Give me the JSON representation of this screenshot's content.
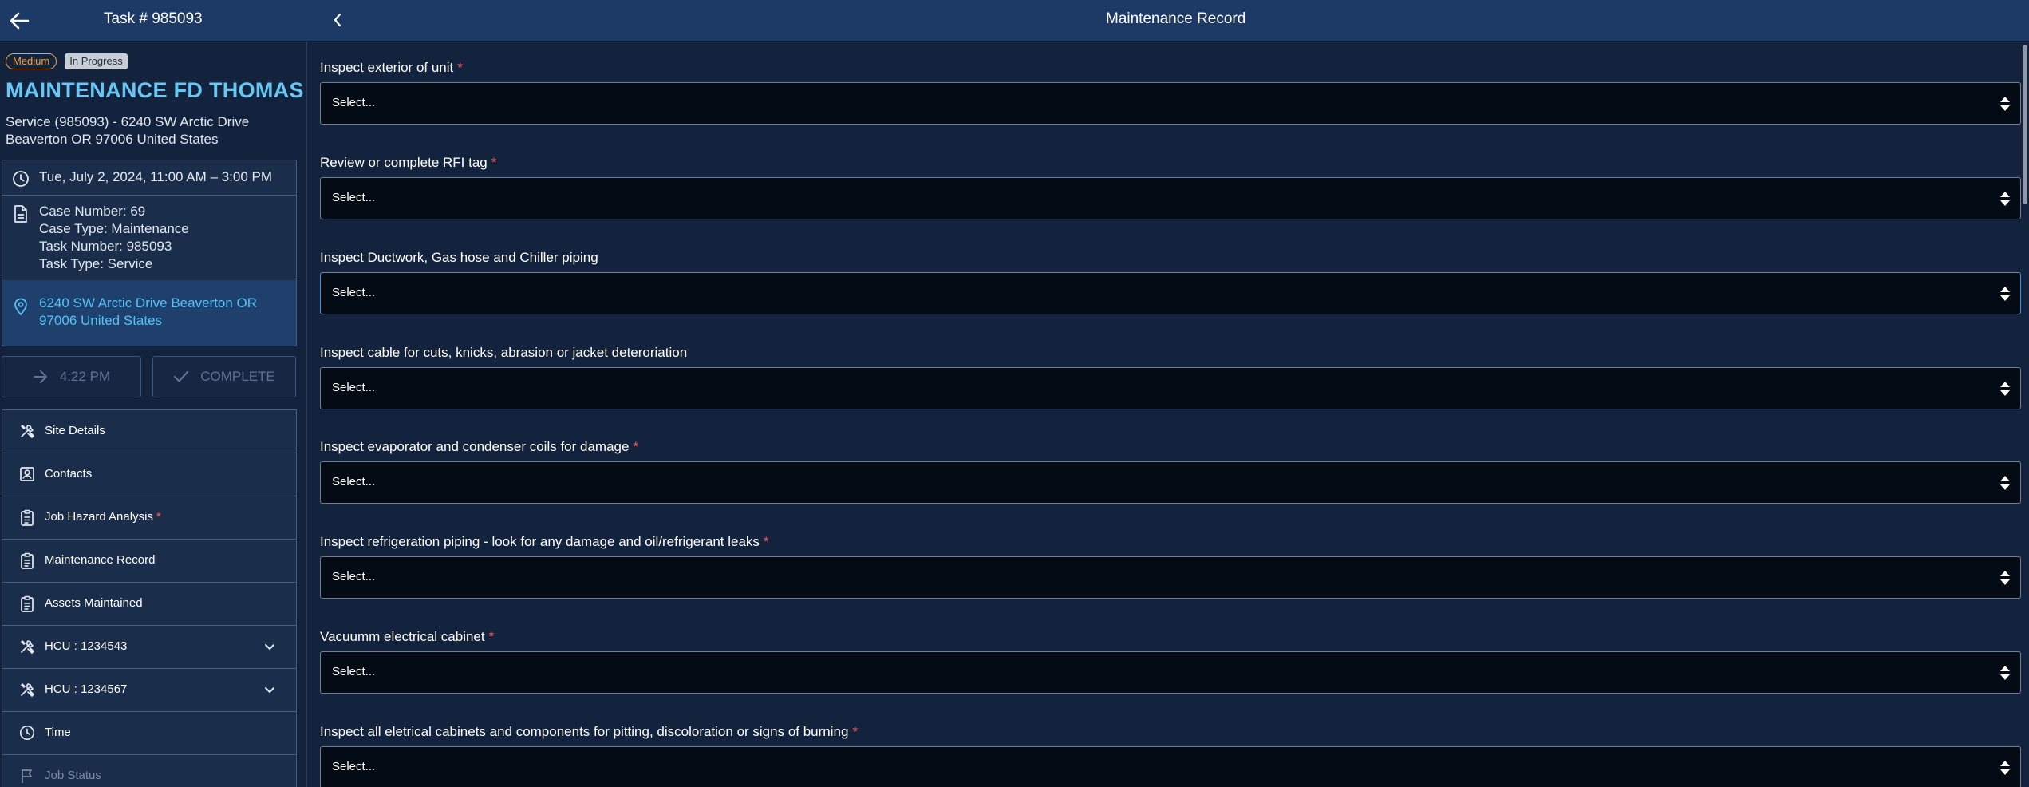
{
  "topbar": {
    "task_label": "Task # 985093",
    "page_title": "Maintenance Record"
  },
  "sidebar": {
    "badge_priority": "Medium",
    "badge_status": "In Progress",
    "title": "MAINTENANCE FD THOMAS",
    "subtitle_line1": "Service (985093) - 6240 SW Arctic Drive",
    "subtitle_line2": "Beaverton OR 97006 United States",
    "schedule": "Tue, July 2, 2024, 11:00 AM – 3:00 PM",
    "case_number": "Case Number: 69",
    "case_type": "Case Type: Maintenance",
    "task_number": "Task Number: 985093",
    "task_type": "Task Type: Service",
    "address": "6240 SW Arctic Drive Beaverton OR 97006 United States",
    "time_button": "4:22 PM",
    "complete_button": "COMPLETE",
    "nav": [
      {
        "label": "Site Details"
      },
      {
        "label": "Contacts"
      },
      {
        "label": "Job Hazard Analysis"
      },
      {
        "label": "Maintenance Record"
      },
      {
        "label": "Assets Maintained"
      },
      {
        "label": "HCU : 1234543"
      },
      {
        "label": "HCU : 1234567"
      },
      {
        "label": "Time"
      },
      {
        "label": "Job Status"
      }
    ],
    "required_mark": "*"
  },
  "form": {
    "fields": [
      {
        "label": "Inspect exterior of unit",
        "required": true,
        "value": "Select..."
      },
      {
        "label": "Review or complete RFI tag",
        "required": true,
        "value": "Select..."
      },
      {
        "label": "Inspect Ductwork, Gas hose and Chiller piping",
        "required": false,
        "value": "Select..."
      },
      {
        "label": "Inspect cable for cuts, knicks, abrasion or jacket deteroriation",
        "required": false,
        "value": "Select..."
      },
      {
        "label": "Inspect evaporator and condenser coils for damage",
        "required": true,
        "value": "Select..."
      },
      {
        "label": "Inspect refrigeration piping - look for any damage and oil/refrigerant leaks",
        "required": true,
        "value": "Select..."
      },
      {
        "label": "Vacuumm electrical cabinet",
        "required": true,
        "value": "Select..."
      },
      {
        "label": "Inspect all eletrical cabinets and components for pitting, discoloration or signs of burning",
        "required": true,
        "value": "Select..."
      }
    ],
    "required_mark": "*"
  },
  "colors": {
    "header_bg": "#1d3a66",
    "page_bg": "#13233d",
    "accent_title": "#66c7f4",
    "address_link": "#57c2f5",
    "required": "#ff5a5a",
    "priority_badge": "#f0a443"
  }
}
